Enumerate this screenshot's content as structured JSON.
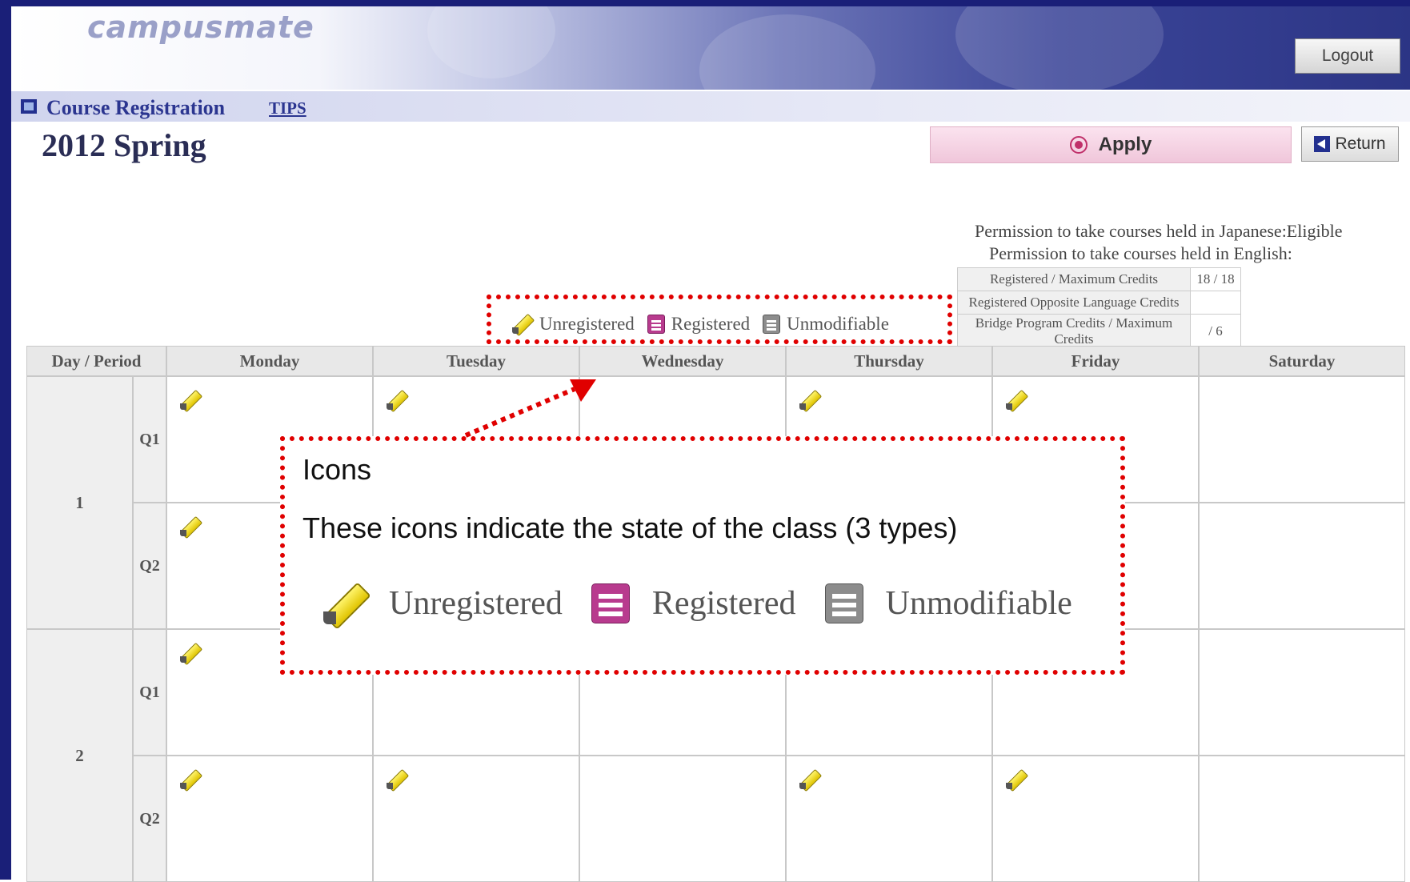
{
  "app": {
    "logo": "campusmate",
    "logout_label": "Logout"
  },
  "titlebar": {
    "title": "Course Registration",
    "tips_label": "TIPS"
  },
  "term": "2012 Spring",
  "actions": {
    "apply_label": "Apply",
    "return_label": "Return"
  },
  "permissions": {
    "japanese": "Permission to take courses held in Japanese:Eligible",
    "english": "Permission to take courses held in English:"
  },
  "credits": [
    {
      "label": "Registered / Maximum Credits",
      "value": "18 / 18"
    },
    {
      "label": "Registered Opposite Language Credits",
      "value": ""
    },
    {
      "label": "Bridge Program Credits / Maximum Credits",
      "value": "/ 6"
    }
  ],
  "legend": {
    "unregistered": "Unregistered",
    "registered": "Registered",
    "unmodifiable": "Unmodifiable"
  },
  "callout": {
    "title": "Icons",
    "description": "These icons indicate the state of the class (3 types)",
    "unregistered": "Unregistered",
    "registered": "Registered",
    "unmodifiable": "Unmodifiable"
  },
  "timetable": {
    "corner_label": "Day / Period",
    "days": [
      "Monday",
      "Tuesday",
      "Wednesday",
      "Thursday",
      "Friday",
      "Saturday"
    ],
    "periods": [
      {
        "label": "1",
        "quarters": [
          {
            "label": "Q1",
            "unregistered": [
              true,
              true,
              false,
              true,
              true,
              false
            ]
          },
          {
            "label": "Q2",
            "unregistered": [
              true,
              false,
              false,
              false,
              false,
              false
            ]
          }
        ]
      },
      {
        "label": "2",
        "quarters": [
          {
            "label": "Q1",
            "unregistered": [
              true,
              false,
              false,
              false,
              false,
              false
            ]
          },
          {
            "label": "Q2",
            "unregistered": [
              true,
              true,
              false,
              true,
              true,
              false
            ]
          }
        ]
      }
    ]
  },
  "colors": {
    "brand_navy": "#1a1f78",
    "callout_red": "#e00000",
    "registered_icon": "#b83b8e",
    "unmodifiable_icon": "#8c8c8c",
    "apply_pink": "#f0c6da"
  }
}
